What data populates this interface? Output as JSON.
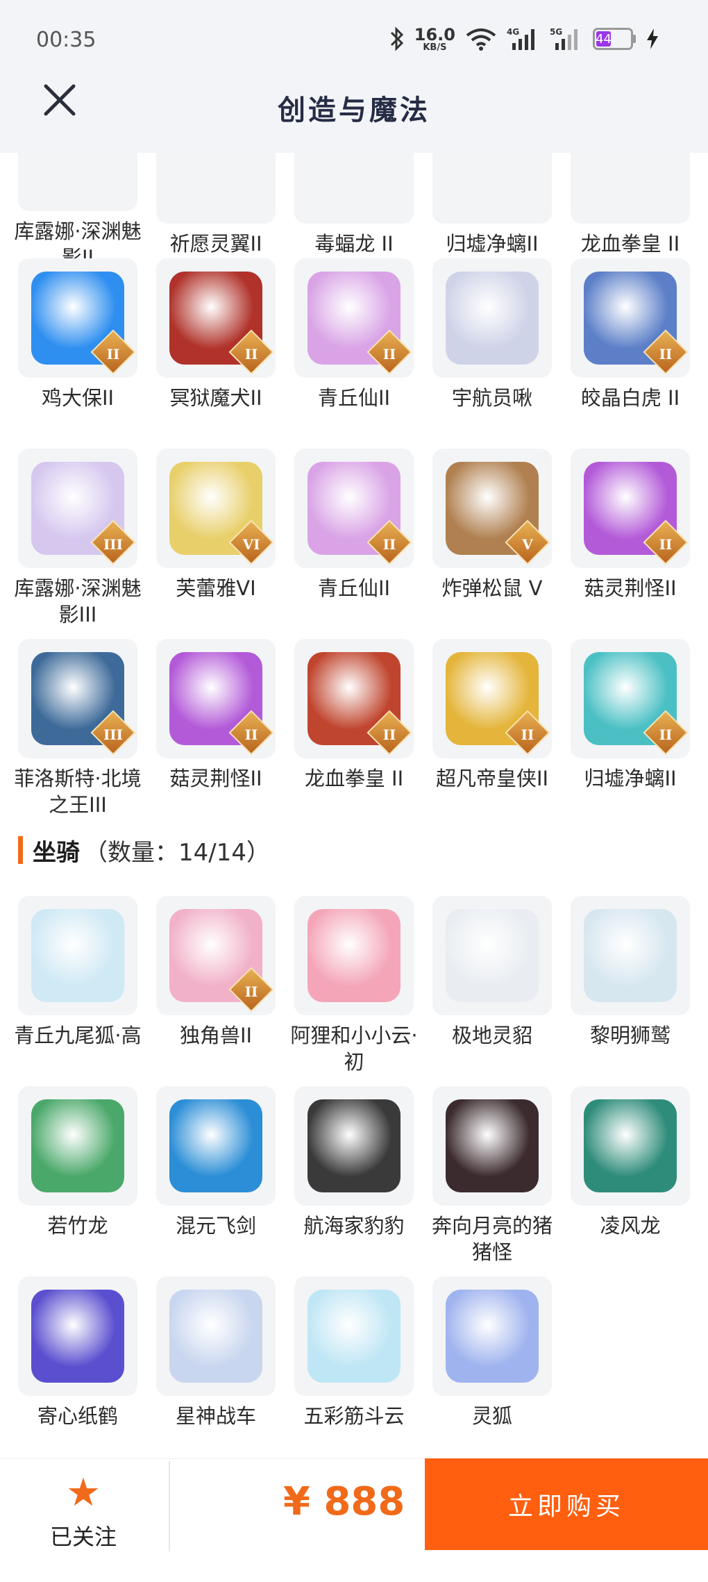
{
  "status_bar": {
    "time": "00:35",
    "net_speed_value": "16.0",
    "net_speed_unit": "KB/S",
    "signal_1": "4G",
    "signal_2": "5G",
    "battery": "44",
    "battery_color": "#9a36e8"
  },
  "header": {
    "title": "创造与魔法"
  },
  "pets_partial_row": [
    {
      "name": "库露娜·深渊魅影II"
    },
    {
      "name": "祈愿灵翼II"
    },
    {
      "name": "毒蝠龙 II"
    },
    {
      "name": "归墟净螭II"
    },
    {
      "name": "龙血拳皇 II"
    }
  ],
  "pets": [
    {
      "name": "鸡大保II",
      "tier": "II",
      "color": "#2f8ff0",
      "icon": "bird-icon"
    },
    {
      "name": "冥狱魔犬II",
      "tier": "II",
      "color": "#b0322a",
      "icon": "dragon-dog-icon"
    },
    {
      "name": "青丘仙II",
      "tier": "II",
      "color": "#d9a3e6",
      "icon": "fox-fairy-icon"
    },
    {
      "name": "宇航员啾",
      "tier": "",
      "color": "#cfd3e8",
      "icon": "astronaut-icon"
    },
    {
      "name": "皎晶白虎 II",
      "tier": "II",
      "color": "#5c7fc8",
      "icon": "tiger-icon"
    },
    {
      "name": "库露娜·深渊魅影III",
      "tier": "III",
      "color": "#d6c7ef",
      "icon": "fairy-icon"
    },
    {
      "name": "芙蕾雅VI",
      "tier": "VI",
      "color": "#e8cf6a",
      "icon": "valkyrie-icon"
    },
    {
      "name": "青丘仙II",
      "tier": "II",
      "color": "#d9a3e6",
      "icon": "fox-fairy-icon"
    },
    {
      "name": "炸弹松鼠 V",
      "tier": "V",
      "color": "#b08050",
      "icon": "squirrel-icon"
    },
    {
      "name": "菇灵荆怪II",
      "tier": "II",
      "color": "#b35ad8",
      "icon": "mushroom-icon"
    },
    {
      "name": "菲洛斯特·北境之王III",
      "tier": "III",
      "color": "#3d6a99",
      "icon": "king-icon"
    },
    {
      "name": "菇灵荆怪II",
      "tier": "II",
      "color": "#b35ad8",
      "icon": "mushroom-icon"
    },
    {
      "name": "龙血拳皇 II",
      "tier": "II",
      "color": "#c0452e",
      "icon": "ram-icon"
    },
    {
      "name": "超凡帝皇侠II",
      "tier": "II",
      "color": "#e4b53a",
      "icon": "armor-hero-icon"
    },
    {
      "name": "归墟净螭II",
      "tier": "II",
      "color": "#4bc0c4",
      "icon": "sea-dragon-icon"
    }
  ],
  "mounts_section": {
    "label": "坐骑",
    "count": "（数量：14/14）"
  },
  "mounts": [
    {
      "name": "青丘九尾狐·高",
      "tier": "",
      "color": "#cfe9f5",
      "icon": "nine-tail-fox-icon"
    },
    {
      "name": "独角兽II",
      "tier": "II",
      "color": "#f1b1c8",
      "icon": "unicorn-icon"
    },
    {
      "name": "阿狸和小小云·初",
      "tier": "",
      "color": "#f4a6b8",
      "icon": "ali-cloud-icon"
    },
    {
      "name": "极地灵貂",
      "tier": "",
      "color": "#e9edf2",
      "icon": "marten-icon"
    },
    {
      "name": "黎明狮鹫",
      "tier": "",
      "color": "#d7e7f0",
      "icon": "griffin-icon"
    },
    {
      "name": "若竹龙",
      "tier": "",
      "color": "#4aa86a",
      "icon": "bamboo-dragon-icon"
    },
    {
      "name": "混元飞剑",
      "tier": "",
      "color": "#2b8ed6",
      "icon": "flying-sword-icon"
    },
    {
      "name": "航海家豹豹",
      "tier": "",
      "color": "#3a3a3a",
      "icon": "pirate-panda-icon"
    },
    {
      "name": "奔向月亮的猪猪怪",
      "tier": "",
      "color": "#3b2a2e",
      "icon": "pig-icon"
    },
    {
      "name": "凌风龙",
      "tier": "",
      "color": "#2e8c7a",
      "icon": "wind-dragon-icon"
    },
    {
      "name": "寄心纸鹤",
      "tier": "",
      "color": "#5a4fcf",
      "icon": "paper-crane-icon"
    },
    {
      "name": "星神战车",
      "tier": "",
      "color": "#c9d6ef",
      "icon": "star-chariot-icon"
    },
    {
      "name": "五彩筋斗云",
      "tier": "",
      "color": "#bfe6f5",
      "icon": "cloud-icon"
    },
    {
      "name": "灵狐",
      "tier": "",
      "color": "#9fb3ee",
      "icon": "spirit-fox-icon"
    }
  ],
  "bottom": {
    "follow_label": "已关注",
    "price": "¥ 888",
    "buy_label": "立即购买",
    "accent": "#ff5f0f"
  }
}
